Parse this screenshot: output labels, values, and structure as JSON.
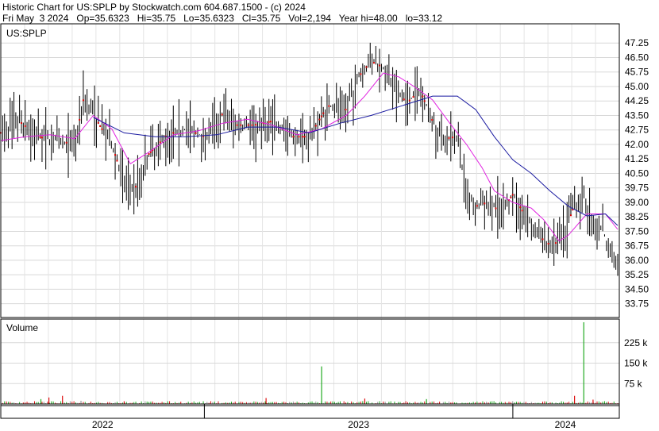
{
  "header": {
    "title": "Historic Chart for US:SPLP by Stockwatch.com 604.687.1500 - (c) 2024",
    "stats": "Fri May  3 2024   Op=35.6323   Hi=35.75   Lo=35.6323   Cl=35.75   Vol=2,194   Year hi=48.00   lo=33.12"
  },
  "chart_data": {
    "type": "ohlc",
    "symbol_label": "US:SPLP",
    "volume_label": "Volume",
    "price_ticks": [
      "47.25",
      "46.50",
      "45.75",
      "45.00",
      "44.25",
      "43.50",
      "42.75",
      "42.00",
      "41.25",
      "40.50",
      "39.75",
      "39.00",
      "38.25",
      "37.50",
      "36.75",
      "36.00",
      "35.25",
      "34.50",
      "33.75"
    ],
    "ylim": [
      33.12,
      48.0
    ],
    "volume_ticks": [
      "225 k",
      "150 k",
      "75 k"
    ],
    "volume_ylim": [
      0,
      300000
    ],
    "x_labels": [
      "2022",
      "2023",
      "2024"
    ],
    "grid": true,
    "colors": {
      "price": "#000000",
      "ma_short": "#e020e0",
      "ma_long": "#1a1aa0",
      "vol_up": "#22aa22",
      "vol_down": "#dd1111",
      "vol_flat": "#999999",
      "marker": "#dd0000"
    },
    "price_series": [
      {
        "t": 0,
        "c": 42.6
      },
      {
        "t": 0.03,
        "c": 43.2
      },
      {
        "t": 0.06,
        "c": 42.4
      },
      {
        "t": 0.09,
        "c": 42.2
      },
      {
        "t": 0.12,
        "c": 42.0
      },
      {
        "t": 0.135,
        "c": 44.5
      },
      {
        "t": 0.16,
        "c": 43.0
      },
      {
        "t": 0.18,
        "c": 42.0
      },
      {
        "t": 0.2,
        "c": 40.0
      },
      {
        "t": 0.22,
        "c": 39.8
      },
      {
        "t": 0.24,
        "c": 41.5
      },
      {
        "t": 0.27,
        "c": 42.5
      },
      {
        "t": 0.3,
        "c": 42.8
      },
      {
        "t": 0.33,
        "c": 42.4
      },
      {
        "t": 0.36,
        "c": 43.6
      },
      {
        "t": 0.38,
        "c": 43.0
      },
      {
        "t": 0.41,
        "c": 43.0
      },
      {
        "t": 0.44,
        "c": 43.2
      },
      {
        "t": 0.47,
        "c": 42.4
      },
      {
        "t": 0.5,
        "c": 42.4
      },
      {
        "t": 0.53,
        "c": 44.0
      },
      {
        "t": 0.56,
        "c": 43.8
      },
      {
        "t": 0.58,
        "c": 45.5
      },
      {
        "t": 0.6,
        "c": 46.3
      },
      {
        "t": 0.62,
        "c": 46.0
      },
      {
        "t": 0.64,
        "c": 44.6
      },
      {
        "t": 0.66,
        "c": 44.2
      },
      {
        "t": 0.68,
        "c": 44.8
      },
      {
        "t": 0.7,
        "c": 43.2
      },
      {
        "t": 0.72,
        "c": 42.3
      },
      {
        "t": 0.74,
        "c": 42.4
      },
      {
        "t": 0.755,
        "c": 39.5
      },
      {
        "t": 0.77,
        "c": 38.8
      },
      {
        "t": 0.79,
        "c": 39.0
      },
      {
        "t": 0.81,
        "c": 38.5
      },
      {
        "t": 0.83,
        "c": 39.4
      },
      {
        "t": 0.85,
        "c": 38.3
      },
      {
        "t": 0.87,
        "c": 37.3
      },
      {
        "t": 0.89,
        "c": 36.8
      },
      {
        "t": 0.91,
        "c": 37.0
      },
      {
        "t": 0.93,
        "c": 38.9
      },
      {
        "t": 0.945,
        "c": 39.3
      },
      {
        "t": 0.96,
        "c": 37.9
      },
      {
        "t": 0.975,
        "c": 37.6
      },
      {
        "t": 0.99,
        "c": 36.3
      },
      {
        "t": 1.0,
        "c": 35.75
      }
    ],
    "ma_short": [
      {
        "t": 0,
        "c": 42.2
      },
      {
        "t": 0.04,
        "c": 42.4
      },
      {
        "t": 0.08,
        "c": 42.5
      },
      {
        "t": 0.12,
        "c": 42.3
      },
      {
        "t": 0.15,
        "c": 43.5
      },
      {
        "t": 0.18,
        "c": 42.8
      },
      {
        "t": 0.21,
        "c": 41.0
      },
      {
        "t": 0.24,
        "c": 41.6
      },
      {
        "t": 0.28,
        "c": 42.5
      },
      {
        "t": 0.32,
        "c": 42.7
      },
      {
        "t": 0.36,
        "c": 43.1
      },
      {
        "t": 0.4,
        "c": 43.3
      },
      {
        "t": 0.44,
        "c": 43.0
      },
      {
        "t": 0.48,
        "c": 42.5
      },
      {
        "t": 0.52,
        "c": 42.8
      },
      {
        "t": 0.56,
        "c": 43.5
      },
      {
        "t": 0.59,
        "c": 44.5
      },
      {
        "t": 0.62,
        "c": 45.7
      },
      {
        "t": 0.645,
        "c": 45.5
      },
      {
        "t": 0.67,
        "c": 45.0
      },
      {
        "t": 0.7,
        "c": 44.3
      },
      {
        "t": 0.73,
        "c": 43.0
      },
      {
        "t": 0.755,
        "c": 42.0
      },
      {
        "t": 0.78,
        "c": 40.8
      },
      {
        "t": 0.8,
        "c": 39.6
      },
      {
        "t": 0.83,
        "c": 39.0
      },
      {
        "t": 0.86,
        "c": 38.7
      },
      {
        "t": 0.88,
        "c": 38.1
      },
      {
        "t": 0.905,
        "c": 37.0
      },
      {
        "t": 0.92,
        "c": 37.3
      },
      {
        "t": 0.95,
        "c": 38.4
      },
      {
        "t": 0.98,
        "c": 38.4
      },
      {
        "t": 1.0,
        "c": 37.6
      }
    ],
    "ma_long": [
      {
        "t": 0.15,
        "c": 43.4
      },
      {
        "t": 0.2,
        "c": 42.6
      },
      {
        "t": 0.25,
        "c": 42.4
      },
      {
        "t": 0.3,
        "c": 42.4
      },
      {
        "t": 0.35,
        "c": 42.5
      },
      {
        "t": 0.4,
        "c": 42.9
      },
      {
        "t": 0.45,
        "c": 42.9
      },
      {
        "t": 0.5,
        "c": 42.6
      },
      {
        "t": 0.55,
        "c": 43.1
      },
      {
        "t": 0.6,
        "c": 43.5
      },
      {
        "t": 0.65,
        "c": 44.0
      },
      {
        "t": 0.7,
        "c": 44.5
      },
      {
        "t": 0.74,
        "c": 44.5
      },
      {
        "t": 0.77,
        "c": 43.8
      },
      {
        "t": 0.8,
        "c": 42.4
      },
      {
        "t": 0.83,
        "c": 41.2
      },
      {
        "t": 0.86,
        "c": 40.5
      },
      {
        "t": 0.89,
        "c": 39.6
      },
      {
        "t": 0.92,
        "c": 38.8
      },
      {
        "t": 0.95,
        "c": 38.3
      },
      {
        "t": 0.98,
        "c": 38.4
      },
      {
        "t": 1.0,
        "c": 37.8
      }
    ],
    "volume_spikes": [
      {
        "t": 0.065,
        "v": 18000,
        "dir": "up"
      },
      {
        "t": 0.078,
        "v": 24000,
        "dir": "down"
      },
      {
        "t": 0.1,
        "v": 30000,
        "dir": "down"
      },
      {
        "t": 0.13,
        "v": 12000,
        "dir": "flat"
      },
      {
        "t": 0.2,
        "v": 10000,
        "dir": "down"
      },
      {
        "t": 0.43,
        "v": 22000,
        "dir": "down"
      },
      {
        "t": 0.52,
        "v": 138000,
        "dir": "up"
      },
      {
        "t": 0.59,
        "v": 20000,
        "dir": "down"
      },
      {
        "t": 0.69,
        "v": 18000,
        "dir": "up"
      },
      {
        "t": 0.945,
        "v": 300000,
        "dir": "up"
      },
      {
        "t": 0.93,
        "v": 30000,
        "dir": "down"
      },
      {
        "t": 0.96,
        "v": 16000,
        "dir": "down"
      }
    ]
  }
}
